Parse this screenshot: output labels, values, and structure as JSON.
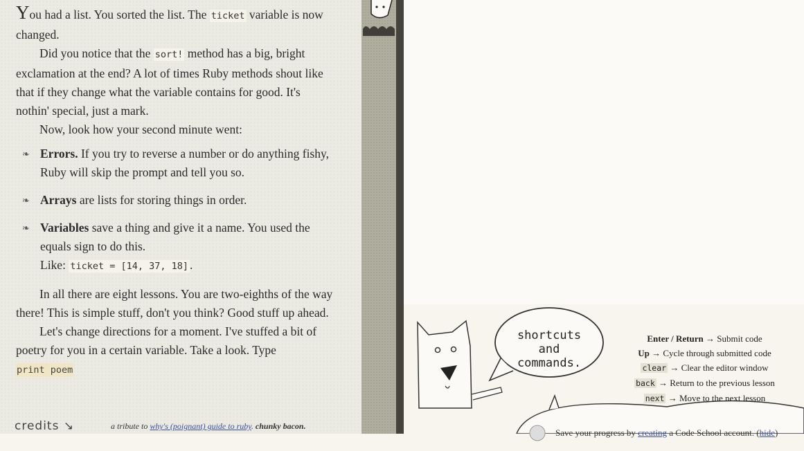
{
  "lesson": {
    "p1_drop": "Y",
    "p1_a": "ou had a list. You sorted the list. The ",
    "p1_code": "ticket",
    "p1_b": " variable is now changed.",
    "p2_a": "Did you notice that the ",
    "p2_code": "sort!",
    "p2_b": " method has a big, bright exclamation at the end? A lot of times Ruby methods shout like that if they change what the variable contains for good. It's nothin' special, just a mark.",
    "p3": "Now, look how your second minute went:",
    "notes": [
      {
        "term": "Errors.",
        "text": " If you try to reverse a number or do anything fishy, Ruby will skip the prompt and tell you so."
      },
      {
        "term": "Arrays",
        "text": " are lists for storing things in order."
      },
      {
        "term": "Variables",
        "text": " save a thing and give it a name. You used the equals sign to do this."
      }
    ],
    "like_label": "Like: ",
    "like_code": "ticket = [14, 37, 18]",
    "like_end": ".",
    "p4": "In all there are eight lessons. You are two-eighths of the way there! This is simple stuff, don't you think? Good stuff up ahead.",
    "p5": "Let's change directions for a moment. I've stuffed a bit of poetry for you in a certain variable. Take a look. Type",
    "p5_cmd": "print poem"
  },
  "footer": {
    "credits": "credits",
    "credits_arrow": "↘",
    "tribute_pre": "a tribute to ",
    "tribute_link": "why's (poignant) guide to ruby",
    "tribute_mid": ". ",
    "tribute_bold": "chunky bacon."
  },
  "help": {
    "bubble_line1": "shortcuts",
    "bubble_line2": "and",
    "bubble_line3": "commands.",
    "shortcuts": [
      {
        "key": "Enter / Return",
        "desc": " → Submit code"
      },
      {
        "key": "Up",
        "desc": " → Cycle through submitted code"
      },
      {
        "code": "clear",
        "desc": " → Clear the editor window"
      },
      {
        "code": "back",
        "desc": " → Return to the previous lesson"
      },
      {
        "code": "next",
        "desc": " → Move to the next lesson"
      }
    ]
  },
  "save": {
    "pre": "Save your progress by ",
    "link": "creating",
    "mid": " a Code School account. (",
    "hide": "hide",
    "end": ")"
  }
}
